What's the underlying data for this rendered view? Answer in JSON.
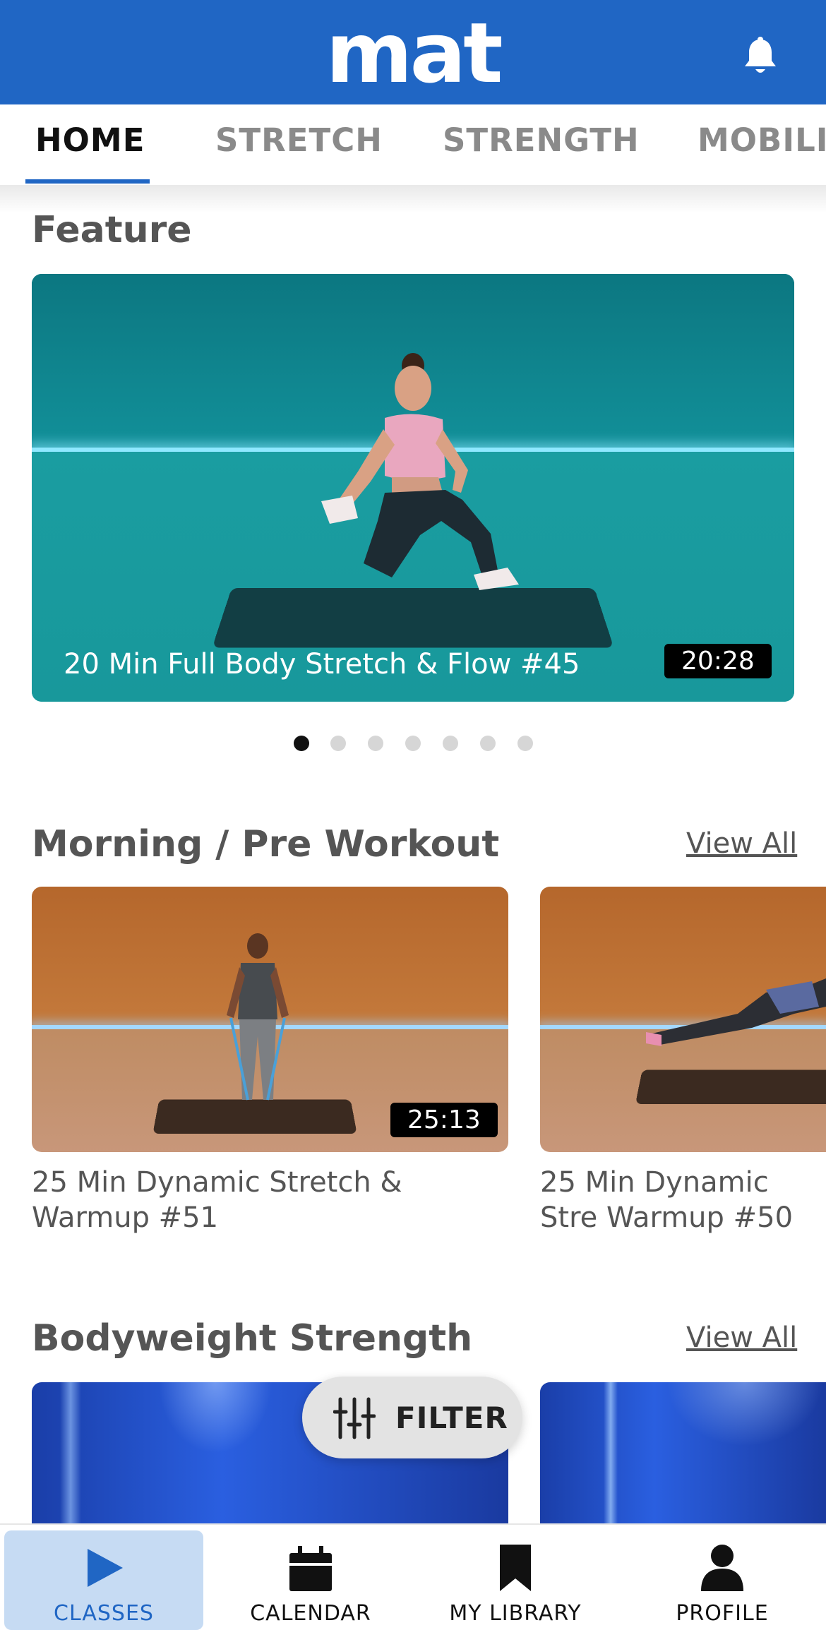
{
  "app": {
    "logo": "mat"
  },
  "tabs": [
    {
      "label": "HOME",
      "active": true
    },
    {
      "label": "STRETCH",
      "active": false
    },
    {
      "label": "STRENGTH",
      "active": false
    },
    {
      "label": "MOBILIT",
      "active": false
    }
  ],
  "feature": {
    "title": "Feature",
    "item": {
      "title": "20 Min Full Body Stretch & Flow #45",
      "duration": "20:28"
    },
    "carousel": {
      "total": 7,
      "active_index": 0
    }
  },
  "morning": {
    "title": "Morning / Pre Workout",
    "view_all": "View All",
    "cards": [
      {
        "title": "25 Min Dynamic Stretch & Warmup #51",
        "duration": "25:13"
      },
      {
        "title": "25 Min Dynamic Stre Warmup #50"
      }
    ]
  },
  "bodyweight": {
    "title": "Bodyweight Strength",
    "view_all": "View All"
  },
  "filter": {
    "label": "FILTER",
    "icon": "sliders-icon"
  },
  "bottom_nav": [
    {
      "label": "CLASSES",
      "icon": "play-icon",
      "active": true
    },
    {
      "label": "CALENDAR",
      "icon": "calendar-icon",
      "active": false
    },
    {
      "label": "MY LIBRARY",
      "icon": "bookmark-icon",
      "active": false
    },
    {
      "label": "PROFILE",
      "icon": "person-icon",
      "active": false
    }
  ],
  "colors": {
    "brand": "#2066c4",
    "active_nav_bg": "#c6dbf3"
  }
}
